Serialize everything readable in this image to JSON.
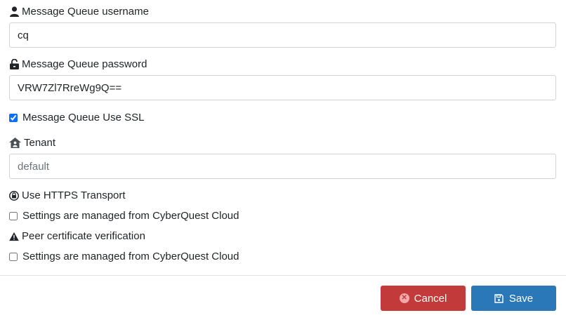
{
  "form": {
    "username": {
      "label": "Message Queue username",
      "value": "cq",
      "icon": "user-icon"
    },
    "password": {
      "label": "Message Queue password",
      "value": "VRW7Zl7RreWg9Q==",
      "icon": "lock-open-icon"
    },
    "use_ssl": {
      "label": "Message Queue Use SSL",
      "checked": true
    },
    "tenant": {
      "label": "Tenant",
      "placeholder": "default",
      "icon": "home-user-icon"
    },
    "https": {
      "label": "Use HTTPS Transport",
      "icon": "circle-lock-icon"
    },
    "https_cloud": {
      "label": "Settings are managed from CyberQuest Cloud",
      "checked": false
    },
    "peer_cert": {
      "label": "Peer certificate verification",
      "icon": "warning-icon"
    },
    "peer_cloud": {
      "label": "Settings are managed from CyberQuest Cloud",
      "checked": false
    }
  },
  "footer": {
    "cancel_label": "Cancel",
    "save_label": "Save"
  },
  "colors": {
    "cancel": "#c23a3a",
    "save": "#2a78b8",
    "checkbox_accent": "#0d6efd"
  }
}
